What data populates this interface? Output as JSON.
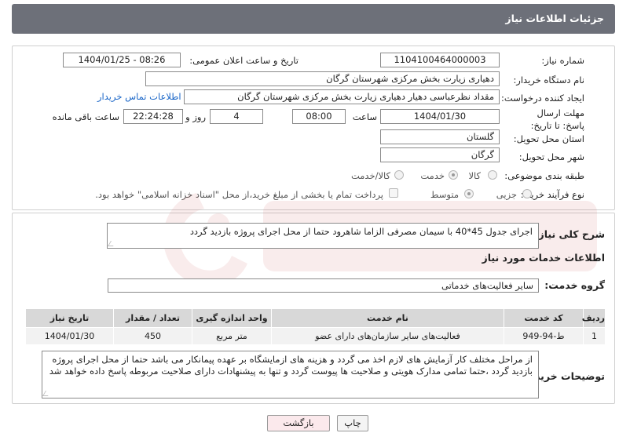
{
  "header": {
    "title": "جزئیات اطلاعات نیاز"
  },
  "form": {
    "need_number_label": "شماره نیاز:",
    "need_number": "1104100464000003",
    "announce_label": "تاریخ و ساعت اعلان عمومی:",
    "announce_value": "1404/01/25 - 08:26",
    "buyer_org_label": "نام دستگاه خریدار:",
    "buyer_org": "دهیاری زیارت بخش مرکزی شهرستان گرگان",
    "creator_label": "ایجاد کننده درخواست:",
    "creator": "مقداد نظرعباسی دهیار دهیاری زیارت بخش مرکزی شهرستان گرگان",
    "contact_link": "اطلاعات تماس خریدار",
    "deadline_label": "مهلت ارسال پاسخ: تا تاریخ:",
    "deadline_date": "1404/01/30",
    "time_label": "ساعت",
    "deadline_time": "08:00",
    "days_value": "4",
    "days_label": "روز و",
    "remaining_time": "22:24:28",
    "remaining_label": "ساعت باقی مانده",
    "province_label": "استان محل تحویل:",
    "province": "گلستان",
    "city_label": "شهر محل تحویل:",
    "city": "گرگان",
    "category_label": "طبقه بندی موضوعی:",
    "category_options": [
      "کالا",
      "خدمت",
      "کالا/خدمت"
    ],
    "category_selected": "خدمت",
    "process_label": "نوع فرآیند خرید :",
    "process_options": [
      "جزیی",
      "متوسط"
    ],
    "process_selected": "متوسط",
    "payment_note": "پرداخت تمام یا بخشی از مبلغ خرید،از محل \"اسناد خزانه اسلامی\" خواهد بود."
  },
  "details": {
    "summary_label": "شرح کلی نیاز:",
    "summary": "اجرای جدول 45*40 با سیمان مصرفی الزاما شاهرود حتما از محل اجرای پروژه بازدید گردد",
    "services_title": "اطلاعات خدمات مورد نیاز",
    "group_label": "گروه خدمت:",
    "group": "سایر فعالیت‌های خدماتی",
    "table": {
      "headers": [
        "ردیف",
        "کد خدمت",
        "نام خدمت",
        "واحد اندازه گیری",
        "تعداد / مقدار",
        "تاریخ نیاز"
      ],
      "rows": [
        [
          "1",
          "ط-94-949",
          "فعالیت‌های سایر سازمان‌های دارای عضو",
          "متر مربع",
          "450",
          "1404/01/30"
        ]
      ]
    },
    "buyer_notes_label": "توضیحات خریدار:",
    "buyer_notes": "از مراحل مختلف کار آزمایش های لازم اخذ می گردد و هزینه های ازمایشگاه بر عهده پیمانکار می باشد حتما از محل اجرای پروژه بازدید گردد ،حتما تمامی مدارک هویتی و صلاحیت ها پیوست گردد و تنها به پیشنهادات دارای صلاحیت مربوطه پاسخ داده خواهد شد"
  },
  "buttons": {
    "print": "چاپ",
    "back": "بازگشت"
  },
  "colors": {
    "header_bg": "#6d7079",
    "link": "#1a66c8",
    "back_btn_bg": "#fbe9ec"
  }
}
